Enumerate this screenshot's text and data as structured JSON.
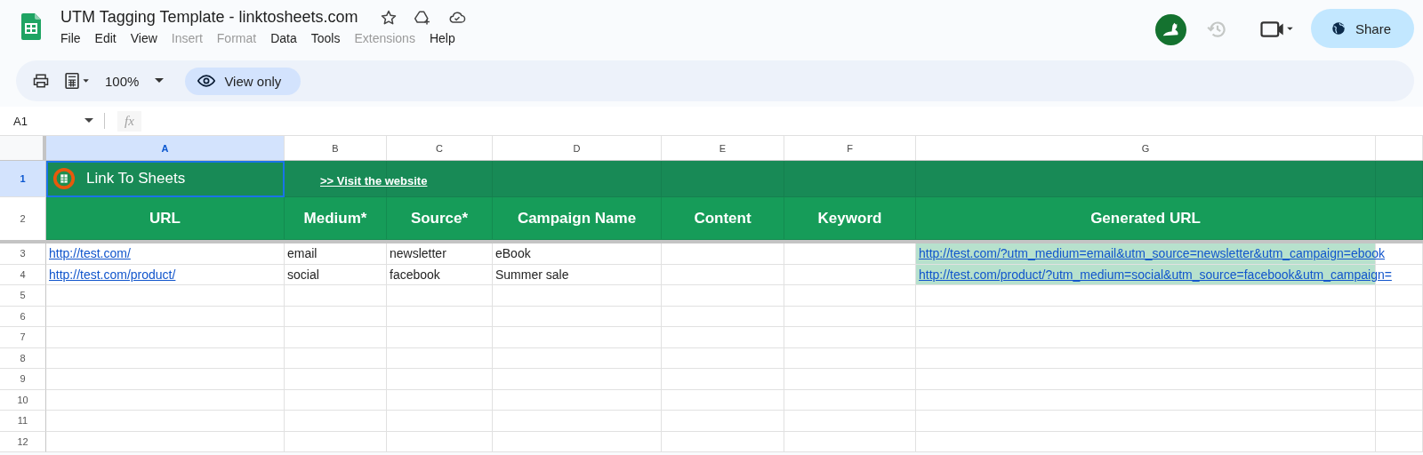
{
  "app": {
    "title": "UTM Tagging Template - linktosheets.com",
    "share_button": "Share",
    "menu": [
      {
        "label": "File",
        "disabled": false
      },
      {
        "label": "Edit",
        "disabled": false
      },
      {
        "label": "View",
        "disabled": false
      },
      {
        "label": "Insert",
        "disabled": true
      },
      {
        "label": "Format",
        "disabled": true
      },
      {
        "label": "Data",
        "disabled": false
      },
      {
        "label": "Tools",
        "disabled": false
      },
      {
        "label": "Extensions",
        "disabled": true
      },
      {
        "label": "Help",
        "disabled": false
      }
    ]
  },
  "toolbar": {
    "zoom": "100%",
    "mode": "View only"
  },
  "formula_bar": {
    "name_box": "A1",
    "fx": "fx"
  },
  "sheet": {
    "columns": [
      {
        "letter": "A",
        "selected": true
      },
      {
        "letter": "B",
        "selected": false
      },
      {
        "letter": "C",
        "selected": false
      },
      {
        "letter": "D",
        "selected": false
      },
      {
        "letter": "E",
        "selected": false
      },
      {
        "letter": "F",
        "selected": false
      },
      {
        "letter": "G",
        "selected": false
      }
    ],
    "rows": [
      {
        "number": "1",
        "selected": true,
        "kind": "banner",
        "brand": "Link To Sheets",
        "link": ">> Visit the website"
      },
      {
        "number": "2",
        "selected": false,
        "kind": "header",
        "cells": [
          "URL",
          "Medium*",
          "Source*",
          "Campaign Name",
          "Content",
          "Keyword",
          "Generated URL"
        ]
      },
      {
        "number": "3",
        "selected": false,
        "kind": "data",
        "cells": [
          {
            "text": "http://test.com/",
            "kind": "link",
            "highlighted": false
          },
          {
            "text": "email",
            "kind": "text",
            "highlighted": false
          },
          {
            "text": "newsletter",
            "kind": "text",
            "highlighted": false
          },
          {
            "text": "eBook",
            "kind": "text",
            "highlighted": false
          },
          {
            "kind": "empty"
          },
          {
            "kind": "empty"
          },
          {
            "text": "http://test.com/?utm_medium=email&utm_source=newsletter&utm_campaign=ebook",
            "kind": "link",
            "highlighted": true
          }
        ]
      },
      {
        "number": "4",
        "selected": false,
        "kind": "data",
        "cells": [
          {
            "text": "http://test.com/product/",
            "kind": "link",
            "highlighted": false
          },
          {
            "text": "social",
            "kind": "text",
            "highlighted": false
          },
          {
            "text": "facebook",
            "kind": "text",
            "highlighted": false
          },
          {
            "text": "Summer sale",
            "kind": "text",
            "highlighted": false
          },
          {
            "kind": "empty"
          },
          {
            "kind": "empty"
          },
          {
            "text": "http://test.com/product/?utm_medium=social&utm_source=facebook&utm_campaign=",
            "kind": "link",
            "highlighted": true
          }
        ]
      },
      {
        "number": "5",
        "selected": false,
        "kind": "data",
        "cells": []
      },
      {
        "number": "6",
        "selected": false,
        "kind": "data",
        "cells": []
      },
      {
        "number": "7",
        "selected": false,
        "kind": "data",
        "cells": []
      },
      {
        "number": "8",
        "selected": false,
        "kind": "data",
        "cells": []
      },
      {
        "number": "9",
        "selected": false,
        "kind": "data",
        "cells": []
      },
      {
        "number": "10",
        "selected": false,
        "kind": "data",
        "cells": []
      },
      {
        "number": "11",
        "selected": false,
        "kind": "data",
        "cells": []
      },
      {
        "number": "12",
        "selected": false,
        "kind": "data",
        "cells": []
      }
    ]
  }
}
